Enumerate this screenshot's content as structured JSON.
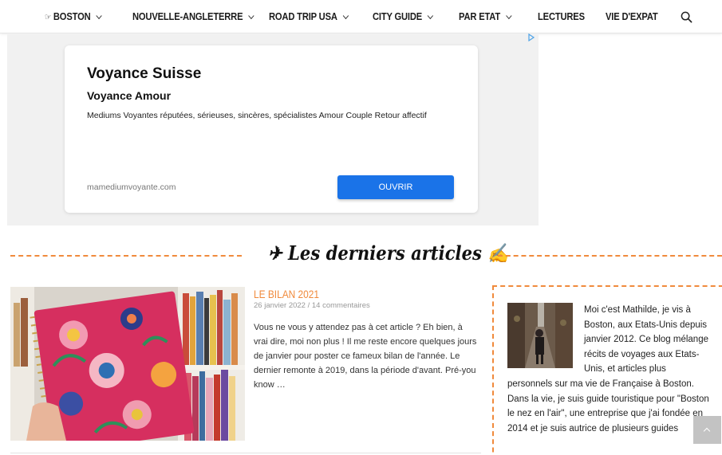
{
  "nav": {
    "items": [
      {
        "label": "BOSTON",
        "prefix": "☞",
        "has_dropdown": true
      },
      {
        "label": "NOUVELLE-ANGLETERRE",
        "has_dropdown": true
      },
      {
        "label": "ROAD TRIP USA",
        "has_dropdown": true
      },
      {
        "label": "CITY GUIDE",
        "has_dropdown": true
      },
      {
        "label": "PAR ETAT",
        "has_dropdown": true
      },
      {
        "label": "LECTURES",
        "has_dropdown": false
      },
      {
        "label": "VIE D'EXPAT",
        "has_dropdown": false
      }
    ],
    "search_icon": "search-icon"
  },
  "ad": {
    "title": "Voyance Suisse",
    "subtitle": "Voyance Amour",
    "description": "Mediums Voyantes réputées, sérieuses, sincères, spécialistes Amour Couple Retour affectif",
    "url": "mamediumvoyante.com",
    "button_label": "OUVRIR",
    "button_color": "#1a73e8"
  },
  "section": {
    "title": "✈ Les derniers articles ✍",
    "accent_color": "#f08a3c"
  },
  "article": {
    "title": "LE BILAN 2021",
    "meta": "26 janvier 2022 / 14 commentaires",
    "excerpt": "Vous ne vous y attendez pas à cet article ? Eh bien, à vrai dire, moi non plus ! Il me reste encore quelques jours de janvier pour poster ce fameux bilan de l'année. Le dernier remonte à 2019, dans la période d'avant. Pré-you know …"
  },
  "bio": {
    "text": "Moi c'est Mathilde, je vis à Boston, aux Etats-Unis depuis janvier 2012. Ce blog mélange récits de voyages aux Etats-Unis, et articles plus personnels sur ma vie de Française à Boston. Dans la vie, je suis guide touristique pour \"Boston le nez en l'air\", une entreprise que j'ai fondée en 2014 et je suis autrice de plusieurs guides"
  },
  "scroll_top": {
    "icon": "chevron-up-icon"
  }
}
